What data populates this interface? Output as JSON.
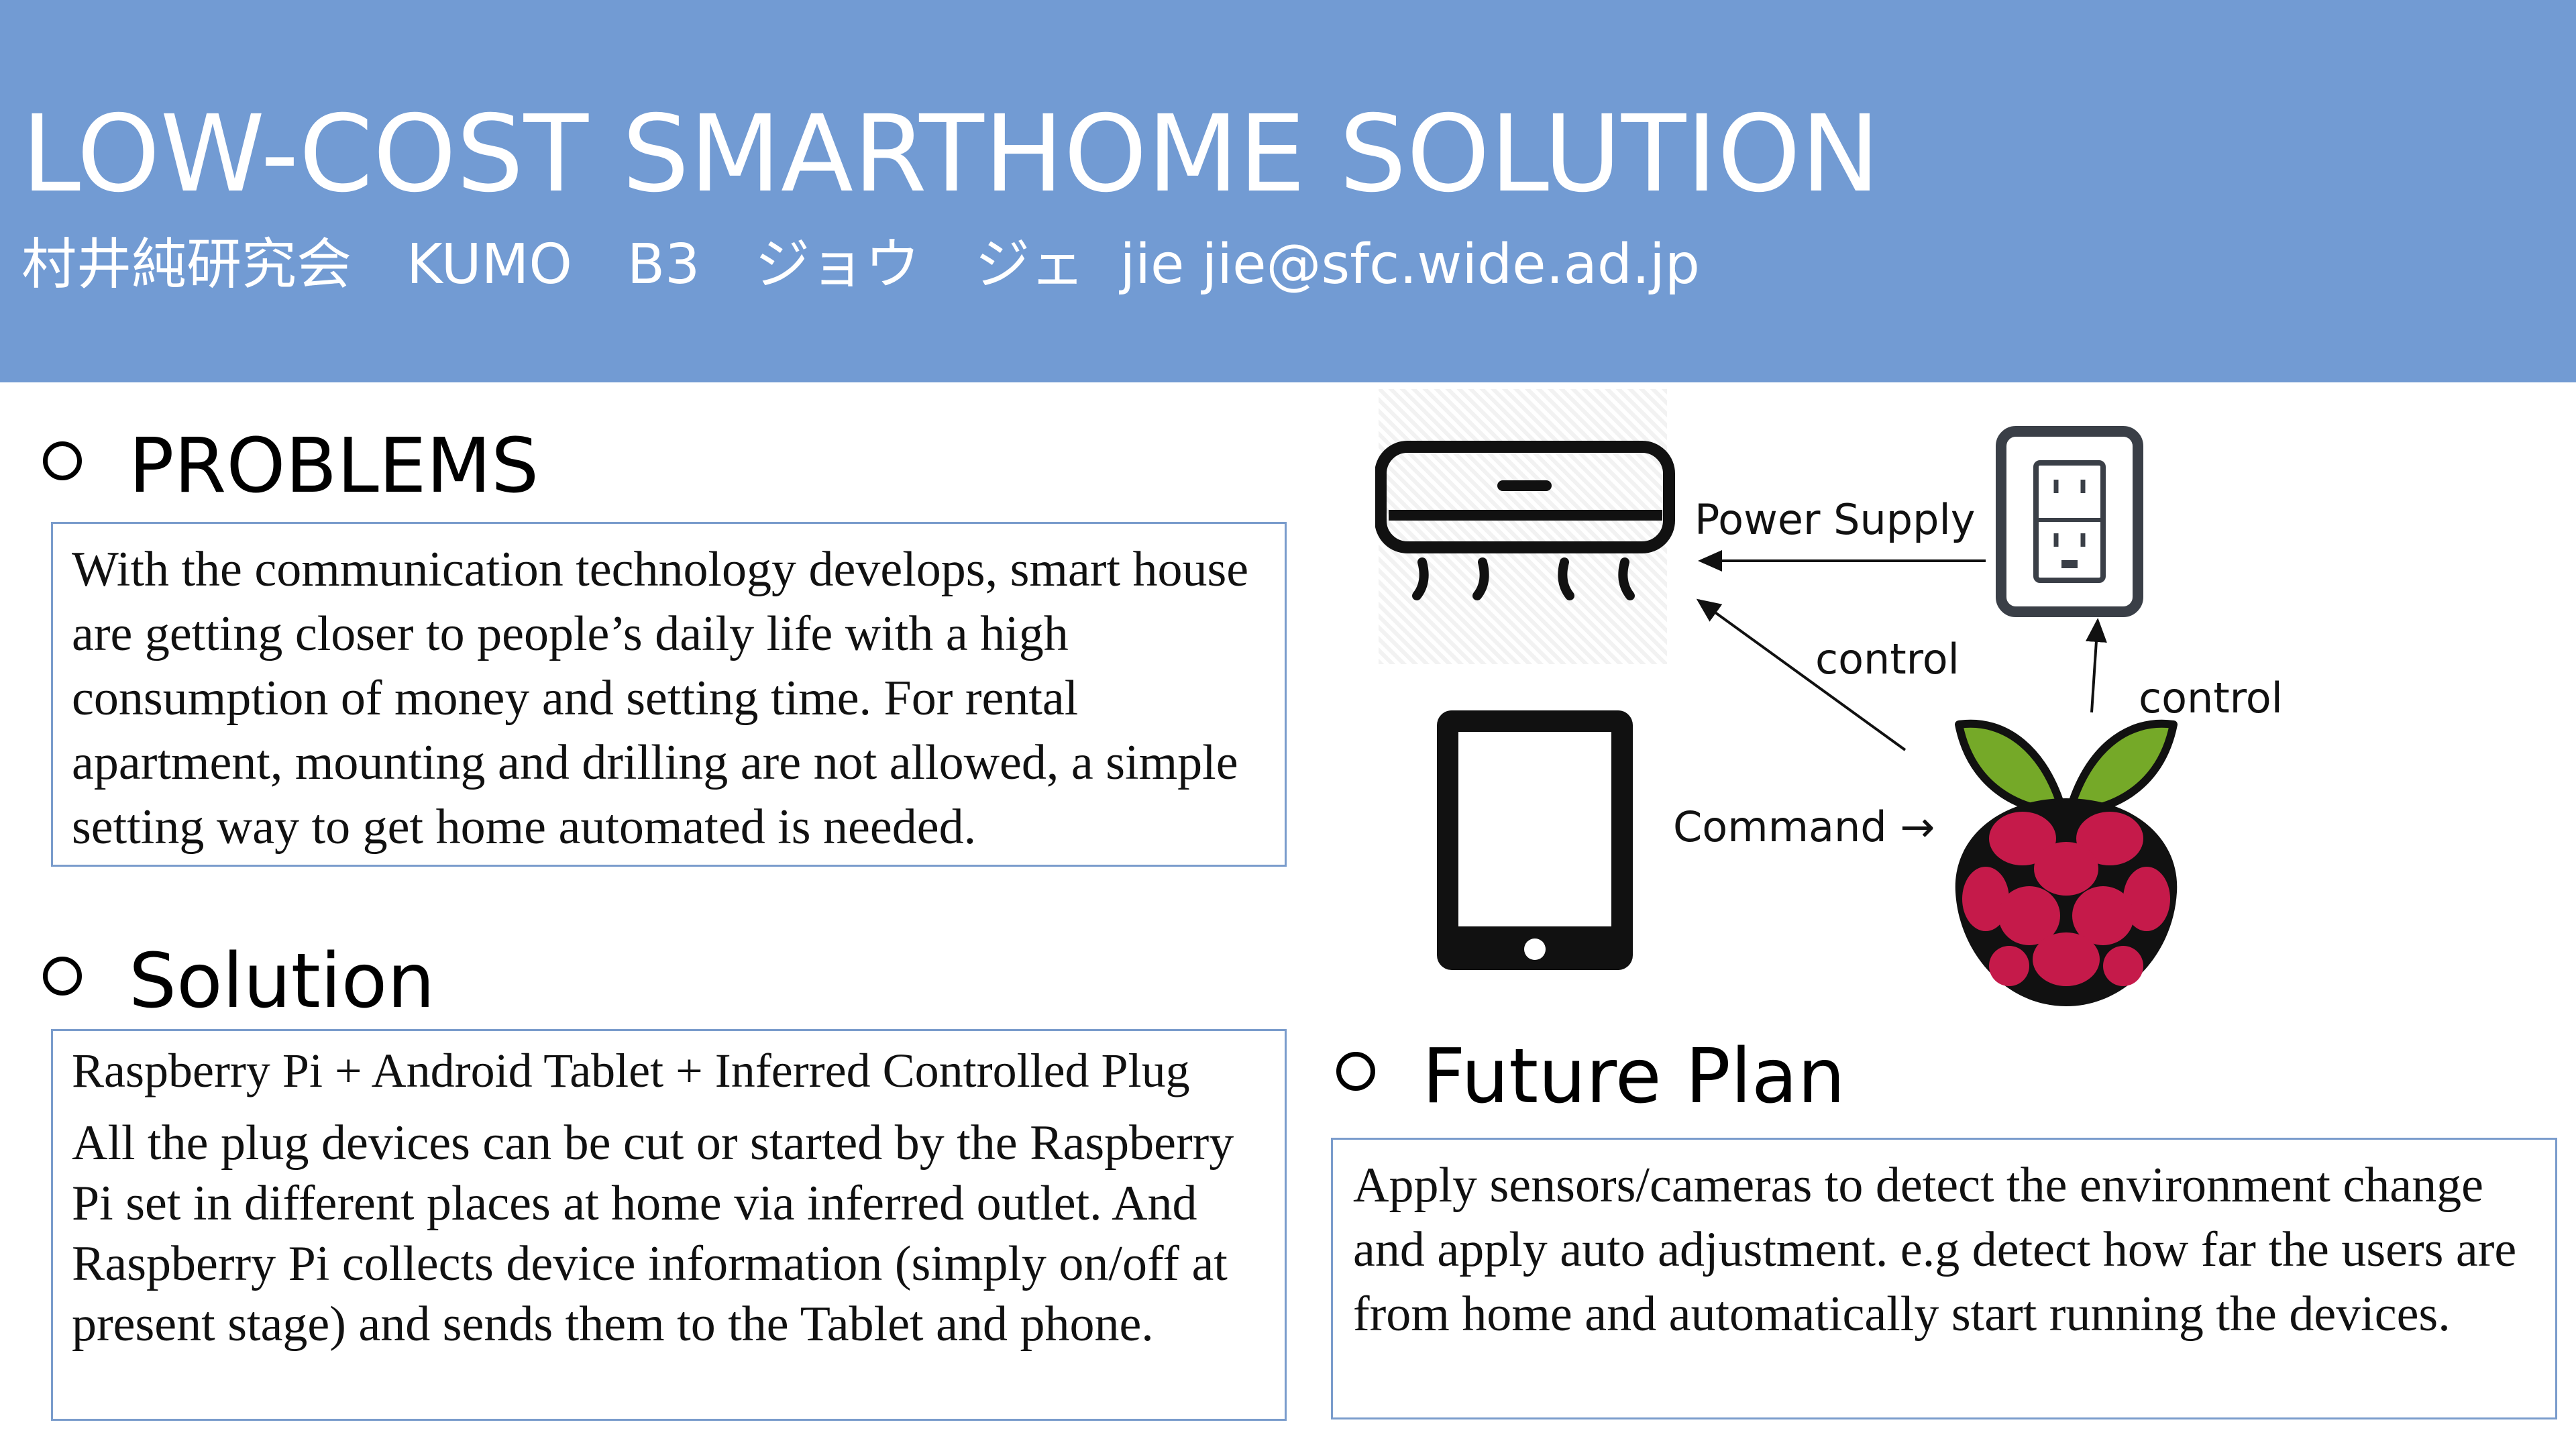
{
  "header": {
    "title": "LOW-COST SMARTHOME SOLUTION",
    "subtitle": "村井純研究会　KUMO　B3　ジョウ　ジェ  jie jie@sfc.wide.ad.jp"
  },
  "problems": {
    "heading": "PROBLEMS",
    "text": "With the communication technology develops, smart house are getting closer to people’s daily life with a high consumption of money and setting time. For rental apartment, mounting and drilling are not allowed, a simple setting way to get home automated is needed."
  },
  "solution": {
    "heading": "Solution",
    "title": "Raspberry Pi + Android Tablet + Inferred Controlled Plug",
    "text": "All the plug devices can be cut or started by the Raspberry Pi set in different places at home via inferred outlet. And Raspberry Pi collects device information (simply on/off at present stage) and sends them to the Tablet and phone."
  },
  "future_plan": {
    "heading": "Future Plan",
    "text": "Apply sensors/cameras to detect the environment change and apply auto adjustment. e.g detect how far the users are from home and automatically start running the devices."
  },
  "diagram": {
    "power_supply": "Power Supply",
    "control_left": "control",
    "control_right": "control",
    "command": "Command →",
    "icons": [
      "air-conditioner-icon",
      "wall-outlet-icon",
      "tablet-icon",
      "raspberry-pi-icon"
    ],
    "colors": {
      "raspberry": "#c51a4a",
      "leaf": "#75a928",
      "header": "#729bd3",
      "box_border": "#7a9ccc"
    }
  }
}
